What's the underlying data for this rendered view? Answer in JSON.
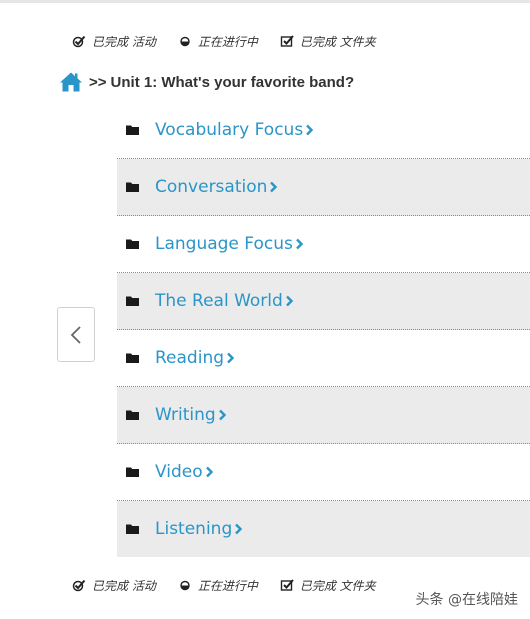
{
  "legend": {
    "completed_activity": "已完成 活动",
    "in_progress": "正在进行中",
    "completed_folder": "已完成 文件夹"
  },
  "breadcrumb": {
    "separator": ">>",
    "title": "Unit 1: What's your favorite band?"
  },
  "sections": [
    {
      "label": "Vocabulary Focus"
    },
    {
      "label": "Conversation"
    },
    {
      "label": "Language Focus"
    },
    {
      "label": "The Real World"
    },
    {
      "label": "Reading"
    },
    {
      "label": "Writing"
    },
    {
      "label": "Video"
    },
    {
      "label": "Listening"
    }
  ],
  "watermark": "头条 @在线陪娃",
  "colors": {
    "link": "#2a95c8",
    "row_alt": "#ebebeb",
    "home_icon": "#2a95c8"
  }
}
